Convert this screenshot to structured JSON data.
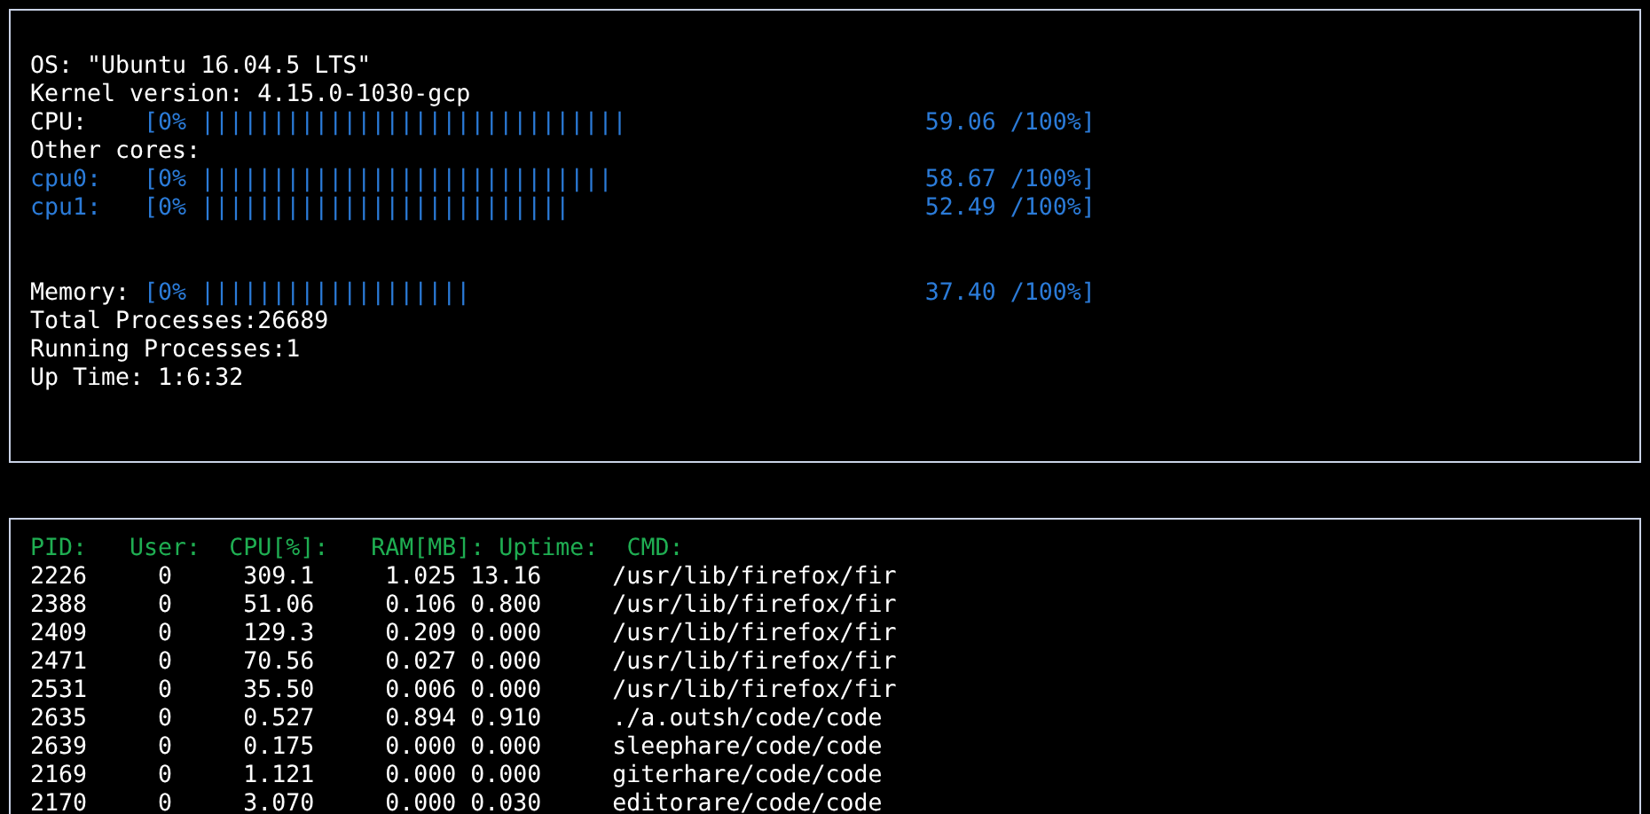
{
  "system": {
    "os_line": "OS: \"Ubuntu 16.04.5 LTS\"",
    "kernel_line": "Kernel version: 4.15.0-1030-gcp",
    "cpu": {
      "label": "CPU:",
      "start": "[0%",
      "bar": "||||||||||||||||||||||||||||||",
      "reading": "59.06 /100%]"
    },
    "cores_heading": "Other cores:",
    "cores": [
      {
        "label": "cpu0:",
        "start": "[0%",
        "bar": "|||||||||||||||||||||||||||||",
        "reading": "58.67 /100%]"
      },
      {
        "label": "cpu1:",
        "start": "[0%",
        "bar": "||||||||||||||||||||||||||",
        "reading": "52.49 /100%]"
      }
    ],
    "memory": {
      "label": "Memory:",
      "start": "[0%",
      "bar": "|||||||||||||||||||",
      "reading": "37.40 /100%]"
    },
    "stats": [
      "Total Processes:26689",
      "Running Processes:1",
      "Up Time: 1:6:32"
    ]
  },
  "processes": {
    "columns": [
      "PID:",
      "User:",
      "CPU[%]:",
      "RAM[MB]:",
      "Uptime:",
      "CMD:"
    ],
    "rows": [
      [
        "2226",
        "0",
        "309.1",
        "1.025",
        "13.16",
        "/usr/lib/firefox/fir"
      ],
      [
        "2388",
        "0",
        "51.06",
        "0.106",
        "0.800",
        "/usr/lib/firefox/fir"
      ],
      [
        "2409",
        "0",
        "129.3",
        "0.209",
        "0.000",
        "/usr/lib/firefox/fir"
      ],
      [
        "2471",
        "0",
        "70.56",
        "0.027",
        "0.000",
        "/usr/lib/firefox/fir"
      ],
      [
        "2531",
        "0",
        "35.50",
        "0.006",
        "0.000",
        "/usr/lib/firefox/fir"
      ],
      [
        "2635",
        "0",
        "0.527",
        "0.894",
        "0.910",
        "./a.outsh/code/code"
      ],
      [
        "2639",
        "0",
        "0.175",
        "0.000",
        "0.000",
        "sleephare/code/code"
      ],
      [
        "2169",
        "0",
        "1.121",
        "0.000",
        "0.000",
        "giterhare/code/code"
      ],
      [
        "2170",
        "0",
        "3.070",
        "0.000",
        "0.030",
        "editorare/code/code"
      ]
    ]
  }
}
